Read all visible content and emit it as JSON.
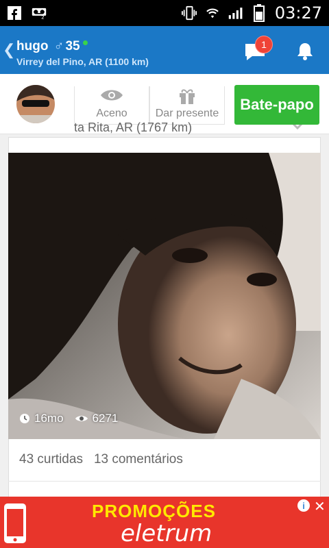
{
  "status": {
    "time": "03:27"
  },
  "header": {
    "name": "hugo",
    "gender_symbol": "♂",
    "age": "35",
    "location": "Virrey del Pino, AR (1100 km)",
    "chat_badge": "1"
  },
  "actions": {
    "wave_label": "Aceno",
    "gift_label": "Dar presente",
    "chat_label": "Bate-papo",
    "behind_location": "ta Rita, AR  (1767 km)"
  },
  "photo": {
    "age": "16mo",
    "views": "6271"
  },
  "counts": {
    "likes": "43 curtidas",
    "comments": "13 comentários"
  },
  "ad": {
    "headline": "PROMOÇÕES",
    "brand": "eletrum"
  },
  "colors": {
    "header_blue": "#1b78c6",
    "chat_green": "#33b838",
    "badge_red": "#ef4337",
    "ad_red": "#e8352b",
    "ad_yellow": "#ffe900"
  }
}
